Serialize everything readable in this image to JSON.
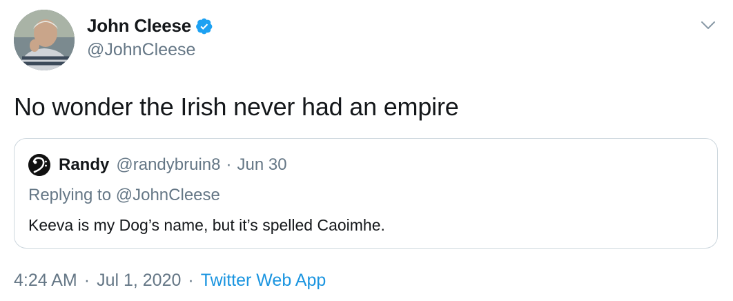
{
  "author": {
    "display_name": "John Cleese",
    "handle": "@JohnCleese",
    "verified_icon": "verified-badge-icon",
    "avatar_icon": "avatar-photo"
  },
  "tweet": {
    "text": "No wonder the Irish never had an empire"
  },
  "quoted_tweet": {
    "display_name": "Randy",
    "handle": "@randybruin8",
    "separator": "·",
    "date": "Jun 30",
    "replying_prefix": "Replying to",
    "replying_to": "@JohnCleese",
    "text": "Keeva is my Dog’s name, but it’s spelled Caoimhe."
  },
  "meta": {
    "time": "4:24 AM",
    "sep1": "·",
    "date": "Jul 1, 2020",
    "sep2": "·",
    "source": "Twitter Web App"
  },
  "colors": {
    "link": "#1b95e0",
    "secondary_text": "#657786",
    "border": "#ccd6dd",
    "verified": "#1da1f2"
  }
}
